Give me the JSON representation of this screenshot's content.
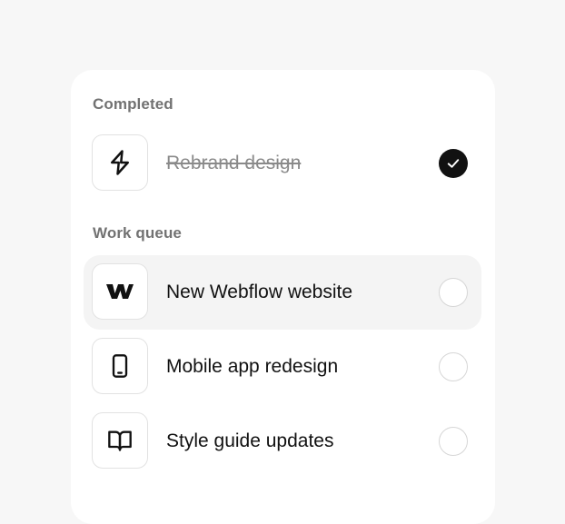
{
  "sections": {
    "completed": {
      "title": "Completed",
      "items": [
        {
          "label": "Rebrand design",
          "icon": "lightning-bolt-icon",
          "checked": true
        }
      ]
    },
    "work_queue": {
      "title": "Work queue",
      "items": [
        {
          "label": "New Webflow website",
          "icon": "webflow-logo-icon",
          "checked": false,
          "highlighted": true
        },
        {
          "label": "Mobile app redesign",
          "icon": "mobile-phone-icon",
          "checked": false
        },
        {
          "label": "Style guide updates",
          "icon": "open-book-icon",
          "checked": false
        }
      ]
    }
  },
  "colors": {
    "page_background": "#f7f7f7",
    "card_background": "#ffffff",
    "highlight_row": "#f4f4f4",
    "checked_fill": "#111111",
    "muted_text": "#727272"
  }
}
